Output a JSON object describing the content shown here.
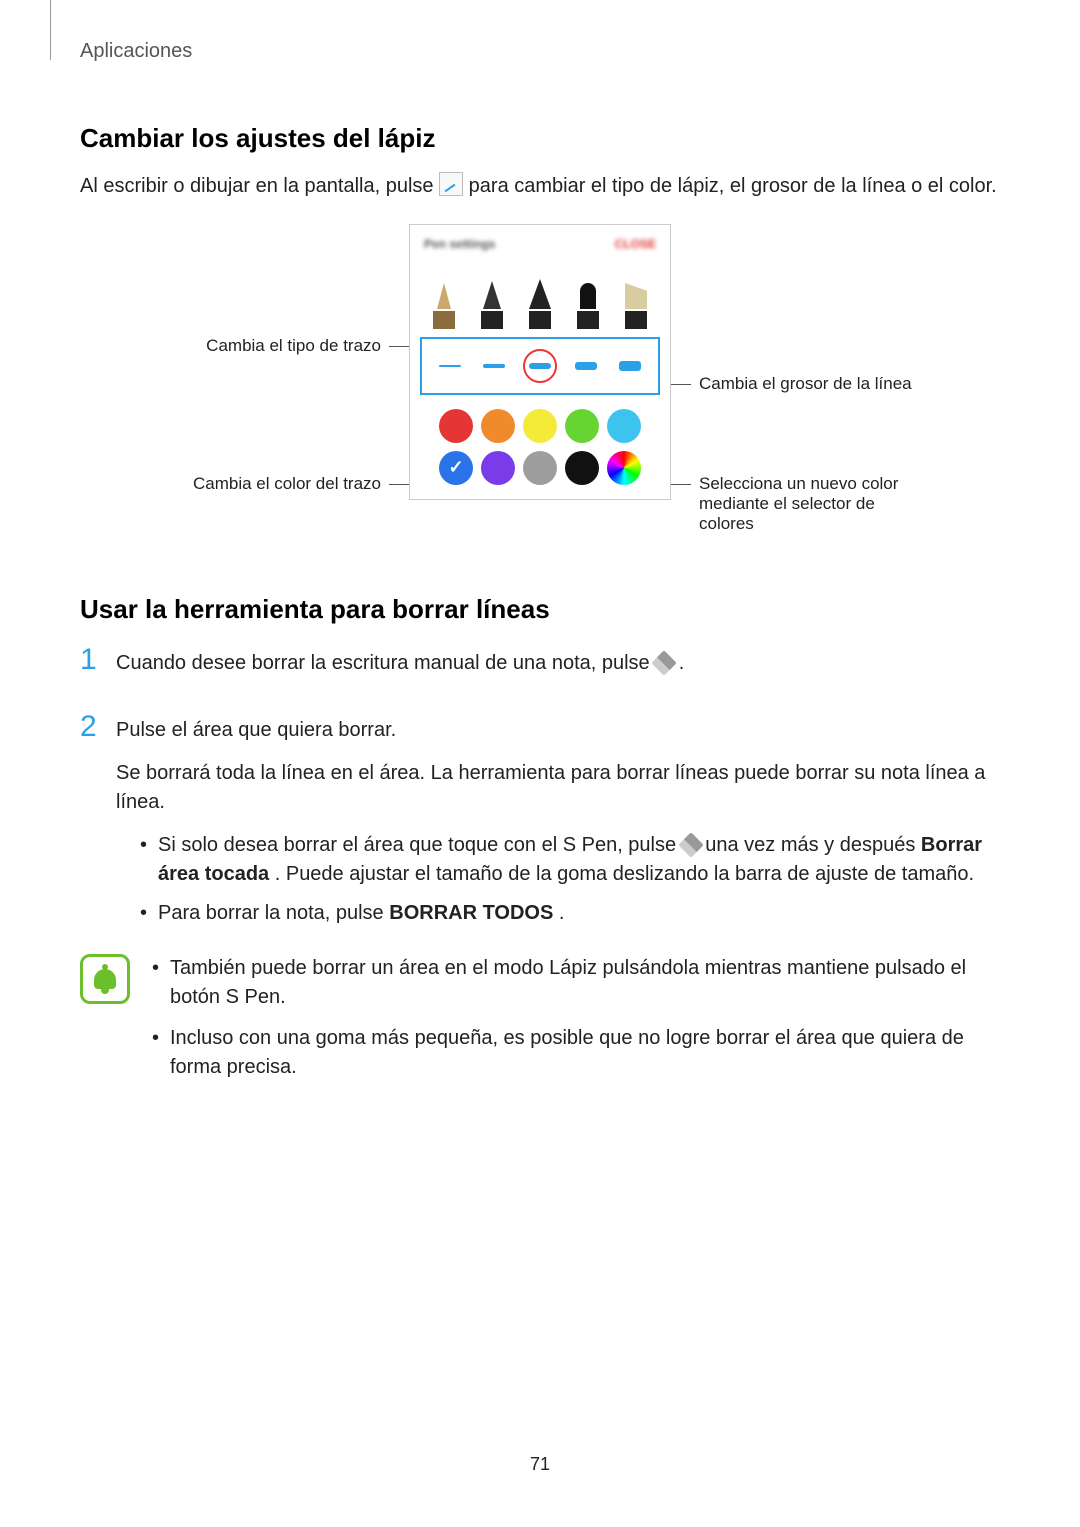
{
  "header": {
    "section": "Aplicaciones"
  },
  "pen": {
    "heading": "Cambiar los ajustes del lápiz",
    "text_a": "Al escribir o dibujar en la pantalla, pulse ",
    "text_b": " para cambiar el tipo de lápiz, el grosor de la línea o el color.",
    "panel": {
      "title": "Pen settings",
      "close": "CLOSE",
      "thickness_selected_index": 2,
      "colors_row1": [
        "#e53535",
        "#f08b2c",
        "#f3ea3a",
        "#66d531",
        "#3cc4ef"
      ],
      "colors_row2": [
        "#2a73e8",
        "#7a3be8",
        "#9e9e9e",
        "#111111",
        "rainbow"
      ],
      "selected_color_index": 5
    },
    "callouts": {
      "nib": "Cambia el tipo de trazo",
      "color": "Cambia el color del trazo",
      "thickness": "Cambia el grosor de la línea",
      "picker": "Selecciona un nuevo color mediante el selector de colores"
    }
  },
  "eraser": {
    "heading": "Usar la herramienta para borrar líneas",
    "step1": {
      "pre": "Cuando desee borrar la escritura manual de una nota, pulse ",
      "post": "."
    },
    "step2": {
      "line1": "Pulse el área que quiera borrar.",
      "line2": "Se borrará toda la línea en el área. La herramienta para borrar líneas puede borrar su nota línea a línea.",
      "b1_pre": "Si solo desea borrar el área que toque con el S Pen, pulse ",
      "b1_mid": " una vez más y después ",
      "b1_bold": "Borrar área tocada",
      "b1_post": ". Puede ajustar el tamaño de la goma deslizando la barra de ajuste de tamaño.",
      "b2_pre": "Para borrar la nota, pulse ",
      "b2_bold": "BORRAR TODOS",
      "b2_post": "."
    },
    "note": {
      "n1": "También puede borrar un área en el modo Lápiz pulsándola mientras mantiene pulsado el botón S Pen.",
      "n2": "Incluso con una goma más pequeña, es posible que no logre borrar el área que quiera de forma precisa."
    }
  },
  "steps": {
    "s1": "1",
    "s2": "2"
  },
  "page_number": "71"
}
